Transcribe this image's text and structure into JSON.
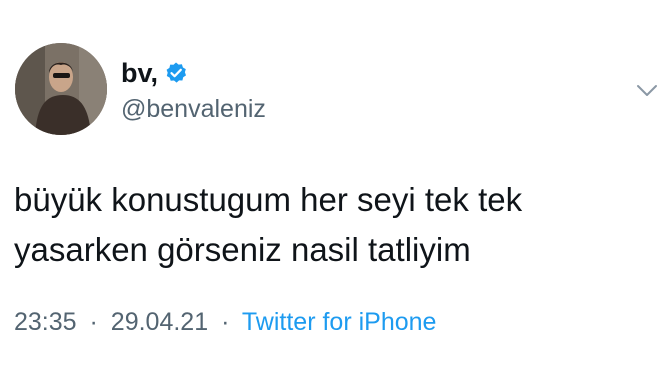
{
  "user": {
    "display_name": "bv,",
    "handle": "@benvaleniz",
    "verified": true,
    "verified_icon": "verified-badge-icon",
    "avatar_icon": "profile-photo"
  },
  "tweet": {
    "text_lines": [
      "büyük konustugum her seyi tek tek",
      "yasarken görseniz nasil tatliyim"
    ],
    "time": "23:35",
    "separator": "·",
    "date": "29.04.21",
    "source": "Twitter for iPhone"
  },
  "menu": {
    "icon": "chevron-down-icon"
  },
  "colors": {
    "text": "#0f1419",
    "secondary": "#536471",
    "accent": "#1d9bf0"
  }
}
